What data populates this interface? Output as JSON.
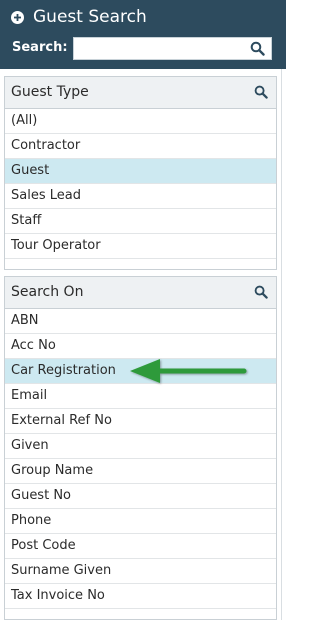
{
  "header": {
    "title": "Guest Search",
    "search_label": "Search:",
    "search_value": "",
    "search_placeholder": ""
  },
  "guest_type": {
    "title": "Guest Type",
    "items": [
      "(All)",
      "Contractor",
      "Guest",
      "Sales Lead",
      "Staff",
      "Tour Operator"
    ],
    "selected": "Guest"
  },
  "search_on": {
    "title": "Search On",
    "items": [
      "ABN",
      "Acc No",
      "Car Registration",
      "Email",
      "External Ref No",
      "Given",
      "Group Name",
      "Guest No",
      "Phone",
      "Post Code",
      "Surname Given",
      "Tax Invoice No"
    ],
    "selected": "Car Registration"
  },
  "colors": {
    "header_bg": "#2d4b5e",
    "selected_row": "#cde9f1",
    "arrow": "#2e9a3a"
  }
}
